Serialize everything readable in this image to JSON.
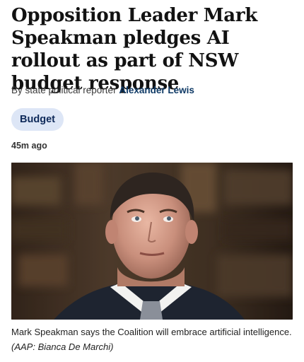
{
  "article": {
    "headline": "Opposition Leader Mark Speakman pledges AI rollout as part of NSW budget response",
    "byline_prefix": "By state political reporter",
    "author": "Alexander Lewis",
    "tag": "Budget",
    "timestamp": "45m ago",
    "image": {
      "subject": "portrait-photo"
    },
    "caption": "Mark Speakman says the Coalition will embrace artificial intelligence.",
    "credit": "(AAP: Bianca De Marchi)"
  }
}
